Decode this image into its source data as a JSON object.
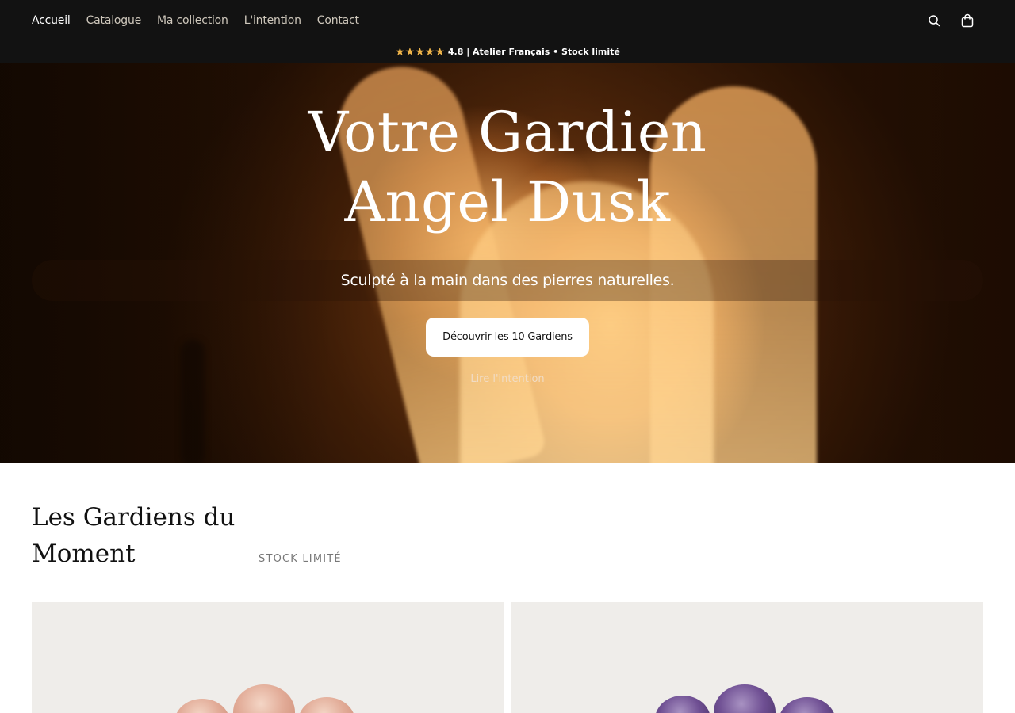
{
  "nav": {
    "items": [
      {
        "label": "Accueil",
        "active": true
      },
      {
        "label": "Catalogue",
        "active": false
      },
      {
        "label": "Ma collection",
        "active": false
      },
      {
        "label": "L'intention",
        "active": false
      },
      {
        "label": "Contact",
        "active": false
      }
    ],
    "icons": [
      "search-icon",
      "cart-icon"
    ]
  },
  "rating_bar": {
    "stars": "★★★★★",
    "text": "4.8 | Atelier Français • Stock limité",
    "star_color": "#f0b54a"
  },
  "hero": {
    "title_line1": "Votre Gardien",
    "title_line2": "Angel Dusk",
    "subtitle": "Sculpté à la main dans des pierres naturelles.",
    "cta_label": "Découvrir les 10 Gardiens",
    "link_label": "Lire l'intention"
  },
  "section": {
    "title": "Les Gardiens du Moment",
    "badge": "STOCK LIMITÉ"
  },
  "products": [
    {
      "stone_color": "#e2ac98"
    },
    {
      "stone_color": "#6f4f93"
    }
  ],
  "colors": {
    "header_bg": "#121212",
    "accent": "#f0b54a"
  }
}
